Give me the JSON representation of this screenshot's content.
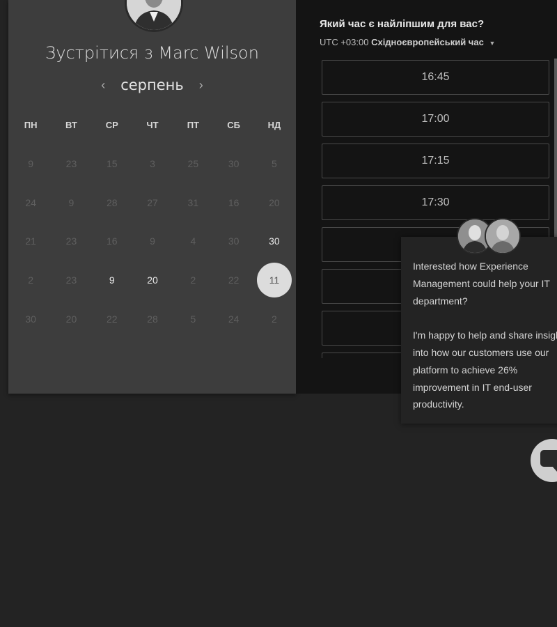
{
  "calendar": {
    "title_prefix": "Зустрітися з",
    "host_name": "Marc Wilson",
    "month": "серпень",
    "prev_icon": "chevron-left-icon",
    "next_icon": "chevron-right-icon",
    "weekdays": [
      "ПН",
      "ВТ",
      "СР",
      "ЧТ",
      "ПТ",
      "СБ",
      "НД"
    ],
    "weeks": [
      [
        {
          "d": "9",
          "s": "dim"
        },
        {
          "d": "23",
          "s": "dim"
        },
        {
          "d": "15",
          "s": "dim"
        },
        {
          "d": "3",
          "s": "dim"
        },
        {
          "d": "25",
          "s": "dim"
        },
        {
          "d": "30",
          "s": "dim"
        },
        {
          "d": "5",
          "s": "dim"
        }
      ],
      [
        {
          "d": "24",
          "s": "dim"
        },
        {
          "d": "9",
          "s": "dim"
        },
        {
          "d": "28",
          "s": "dim"
        },
        {
          "d": "27",
          "s": "dim"
        },
        {
          "d": "31",
          "s": "dim"
        },
        {
          "d": "16",
          "s": "dim"
        },
        {
          "d": "20",
          "s": "dim"
        }
      ],
      [
        {
          "d": "21",
          "s": "dim"
        },
        {
          "d": "23",
          "s": "dim"
        },
        {
          "d": "16",
          "s": "dim"
        },
        {
          "d": "9",
          "s": "dim"
        },
        {
          "d": "4",
          "s": "dim"
        },
        {
          "d": "30",
          "s": "dim"
        },
        {
          "d": "30",
          "s": "avail"
        }
      ],
      [
        {
          "d": "2",
          "s": "dim"
        },
        {
          "d": "23",
          "s": "dim"
        },
        {
          "d": "9",
          "s": "avail"
        },
        {
          "d": "20",
          "s": "avail"
        },
        {
          "d": "2",
          "s": "dim"
        },
        {
          "d": "22",
          "s": "dim"
        },
        {
          "d": "11",
          "s": "selected"
        }
      ],
      [
        {
          "d": "30",
          "s": "dim"
        },
        {
          "d": "20",
          "s": "dim"
        },
        {
          "d": "22",
          "s": "dim"
        },
        {
          "d": "28",
          "s": "dim"
        },
        {
          "d": "5",
          "s": "dim"
        },
        {
          "d": "24",
          "s": "dim"
        },
        {
          "d": "2",
          "s": "dim"
        }
      ]
    ]
  },
  "times": {
    "question": "Який час є найліпшим для вас?",
    "timezone_offset": "UTC +03:00",
    "timezone_name": "Східноєвропейський час",
    "timezone_caret_icon": "caret-down-icon",
    "slots": [
      "16:45",
      "17:00",
      "17:15",
      "17:30",
      "",
      "",
      "",
      ""
    ]
  },
  "chat": {
    "message": "Interested how Experience Management could help your IT department?\n\nI'm happy to help and share insight into how our customers use our platform to achieve 26% improvement in IT end-user productivity.",
    "launcher_icon": "chat-bubble-icon"
  },
  "colors": {
    "background": "#232323",
    "calendar_panel": "#3d3d3d",
    "time_panel": "#141414",
    "selected_day": "#dcdcdc"
  }
}
